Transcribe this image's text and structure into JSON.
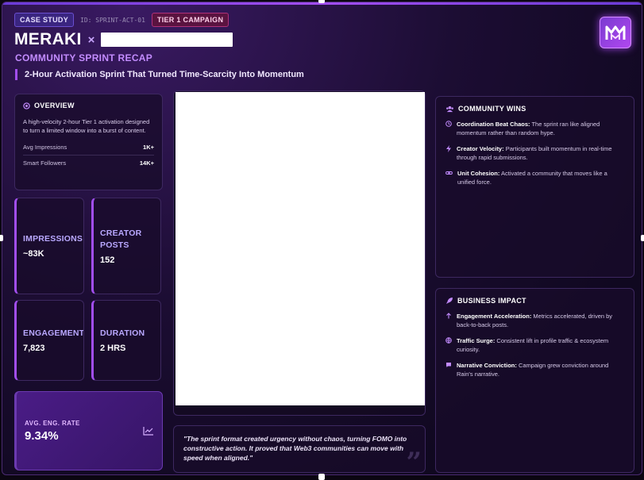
{
  "header": {
    "tag_case": "CASE STUDY",
    "tag_id": "ID: SPRINT-ACT-01",
    "tag_tier": "TIER 1 CAMPAIGN",
    "title": "MERAKI",
    "title_separator": "×",
    "subtitle": "COMMUNITY SPRINT RECAP",
    "tagline": "2-Hour Activation Sprint That Turned Time-Scarcity Into Momentum"
  },
  "overview": {
    "heading": "OVERVIEW",
    "description": "A high-velocity 2-hour Tier 1 activation designed to turn a limited window into a burst of content.",
    "stats": [
      {
        "label": "Avg Impressions",
        "value": "1K+"
      },
      {
        "label": "Smart Followers",
        "value": "14K+"
      }
    ]
  },
  "metrics": [
    {
      "label": "IMPRESSIONS",
      "value": "~83K"
    },
    {
      "label": "CREATOR POSTS",
      "value": "152"
    },
    {
      "label": "ENGAGEMENTS",
      "value": "7,823"
    },
    {
      "label": "DURATION",
      "value": "2 HRS"
    }
  ],
  "rate": {
    "label": "AVG. ENG. RATE",
    "value": "9.34%"
  },
  "quote": "\"The sprint format created urgency without chaos, turning FOMO into constructive action. It proved that Web3 communities can move with speed when aligned.\"",
  "community_wins": {
    "heading": "COMMUNITY WINS",
    "items": [
      {
        "title": "Coordination Beat Chaos:",
        "text": " The sprint ran like aligned momentum rather than random hype."
      },
      {
        "title": "Creator Velocity:",
        "text": " Participants built momentum in real-time through rapid submissions."
      },
      {
        "title": "Unit Cohesion:",
        "text": " Activated a community that moves like a unified force."
      }
    ]
  },
  "business_impact": {
    "heading": "BUSINESS IMPACT",
    "items": [
      {
        "title": "Engagement Acceleration:",
        "text": " Metrics accelerated, driven by back-to-back posts."
      },
      {
        "title": "Traffic Surge:",
        "text": " Consistent lift in profile traffic & ecosystem curiosity."
      },
      {
        "title": "Narrative Conviction:",
        "text": " Campaign grew conviction around Rain's narrative."
      }
    ]
  },
  "colors": {
    "accent": "#a24ef0",
    "label": "#b9a8ff",
    "background": "#1c0d33"
  }
}
